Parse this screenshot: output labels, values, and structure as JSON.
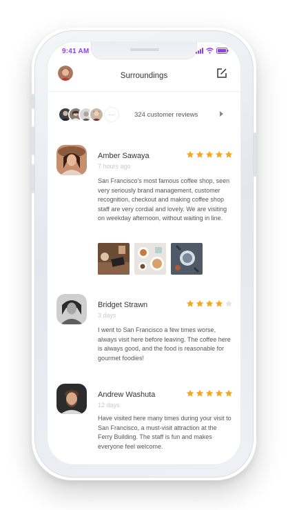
{
  "status": {
    "time": "9:41 AM"
  },
  "header": {
    "title": "Surroundings"
  },
  "reviewers_strip": {
    "more_label": "···",
    "count_label": "324 customer reviews"
  },
  "colors": {
    "accent": "#8e3df0",
    "star_on": "#f5a623",
    "star_off": "#e4e5e8"
  },
  "reviews": [
    {
      "name": "Amber Sawaya",
      "time": "7 hours ago",
      "rating": 5,
      "text": "San Francisco's most famous coffee shop, seen very seriously brand management, customer recognition, checkout and making coffee shop staff are very cordial and lovely. We are visiting on weekday afternoon, without waiting in line."
    },
    {
      "name": "Bridget Strawn",
      "time": "3 days",
      "rating": 4,
      "text": "I went to San Francisco a few times worse, always visit here before leaving. The coffee here is always good, and the food is reasonable for gourmet foodies!"
    },
    {
      "name": "Andrew Washuta",
      "time": "12 days",
      "rating": 5,
      "text": "Have visited here many times during your visit to San Francisco, a must-visit attraction at the Ferry Building. The staff is fun and makes everyone feel welcome."
    }
  ]
}
